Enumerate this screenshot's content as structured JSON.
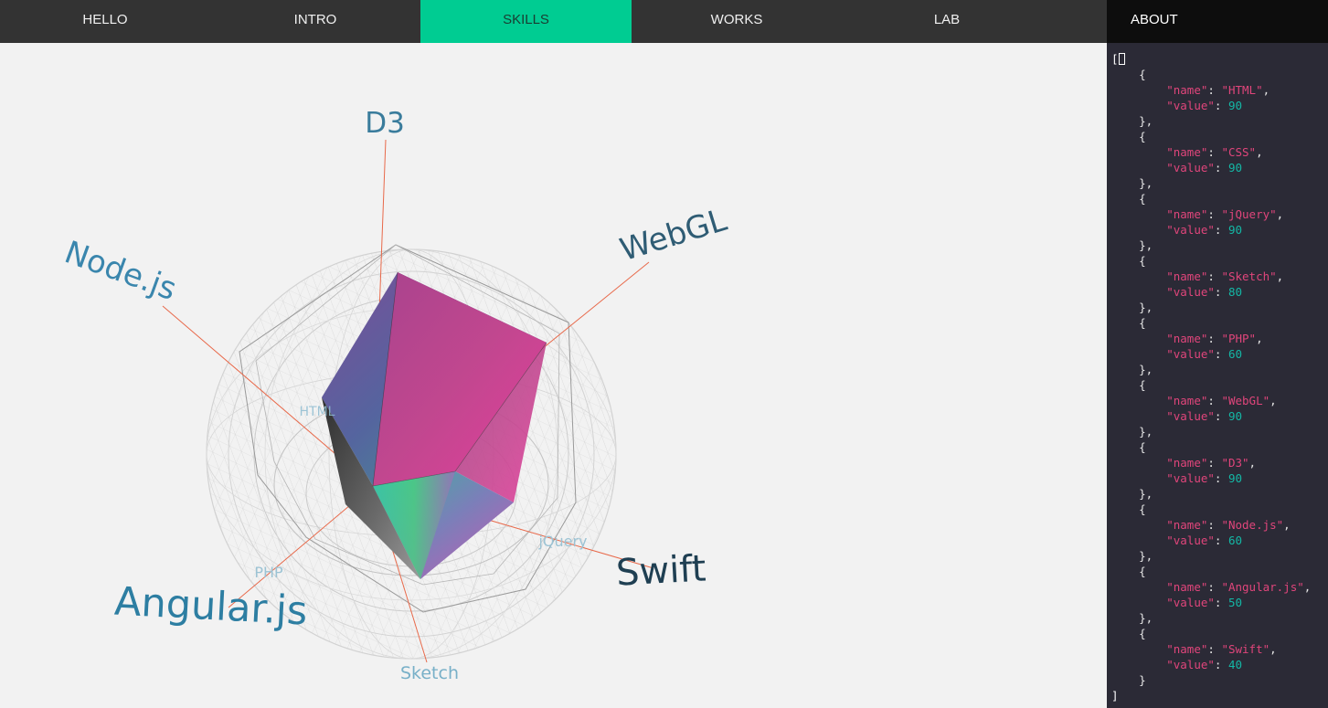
{
  "nav": [
    {
      "label": "HELLO",
      "active": false
    },
    {
      "label": "INTRO",
      "active": false
    },
    {
      "label": "SKILLS",
      "active": true
    },
    {
      "label": "WORKS",
      "active": false
    },
    {
      "label": "LAB",
      "active": false
    },
    {
      "label": "ABOUT",
      "active": false
    }
  ],
  "colors": {
    "nav_bg": "#333333",
    "nav_active": "#00cc92",
    "nav_about": "#0d0d0d",
    "panel_bg": "#2b2a36",
    "key": "#e0457b",
    "number": "#14b8a6",
    "axis": "#e8694a"
  },
  "skills": [
    {
      "name": "HTML",
      "value": 90
    },
    {
      "name": "CSS",
      "value": 90
    },
    {
      "name": "jQuery",
      "value": 90
    },
    {
      "name": "Sketch",
      "value": 80
    },
    {
      "name": "PHP",
      "value": 60
    },
    {
      "name": "WebGL",
      "value": 90
    },
    {
      "name": "D3",
      "value": 90
    },
    {
      "name": "Node.js",
      "value": 60
    },
    {
      "name": "Angular.js",
      "value": 50
    },
    {
      "name": "Swift",
      "value": 40
    }
  ],
  "code": {
    "key_name": "\"name\"",
    "key_value": "\"value\"",
    "open_array": "[",
    "close_array": "]"
  },
  "labels": {
    "d3": "D3",
    "webgl": "WebGL",
    "nodejs": "Node.js",
    "swift": "Swift",
    "angularjs": "Angular.js",
    "sketch": "Sketch",
    "jquery": "jQuery",
    "php": "PHP",
    "html": "HTML"
  }
}
